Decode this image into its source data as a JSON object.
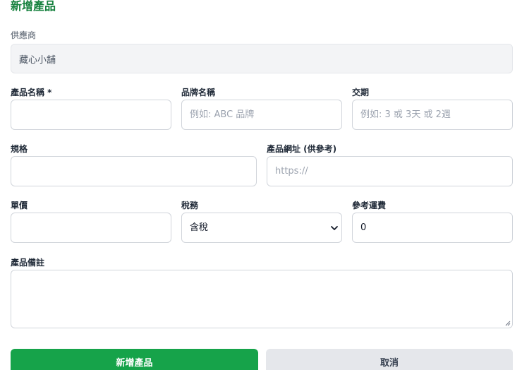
{
  "form": {
    "title": "新增產品",
    "supplier": {
      "label": "供應商",
      "value": "藏心小舖"
    },
    "product_name": {
      "label": "產品名稱 *",
      "value": "",
      "placeholder": ""
    },
    "brand_name": {
      "label": "品牌名稱",
      "value": "",
      "placeholder": "例如: ABC 品牌"
    },
    "lead_time": {
      "label": "交期",
      "value": "",
      "placeholder": "例如: 3 或 3天 或 2週"
    },
    "spec": {
      "label": "規格",
      "value": "",
      "placeholder": ""
    },
    "product_url": {
      "label": "產品網址 (供參考)",
      "value": "",
      "placeholder": "https://"
    },
    "unit_price": {
      "label": "單價",
      "value": "",
      "placeholder": ""
    },
    "tax": {
      "label": "稅務",
      "selected": "含稅"
    },
    "ref_shipping": {
      "label": "參考運費",
      "value": "0"
    },
    "notes": {
      "label": "產品備註",
      "value": ""
    }
  },
  "actions": {
    "submit_label": "新增產品",
    "cancel_label": "取消"
  },
  "icons": {
    "select_arrow": "chevron-down-icon",
    "textarea_grip": "resize-grip-icon"
  },
  "colors": {
    "accent": "#16a34a",
    "title": "#15803d",
    "border": "#d1d5db",
    "readonly_bg": "#f3f4f6",
    "secondary_bg": "#e5e7eb"
  }
}
